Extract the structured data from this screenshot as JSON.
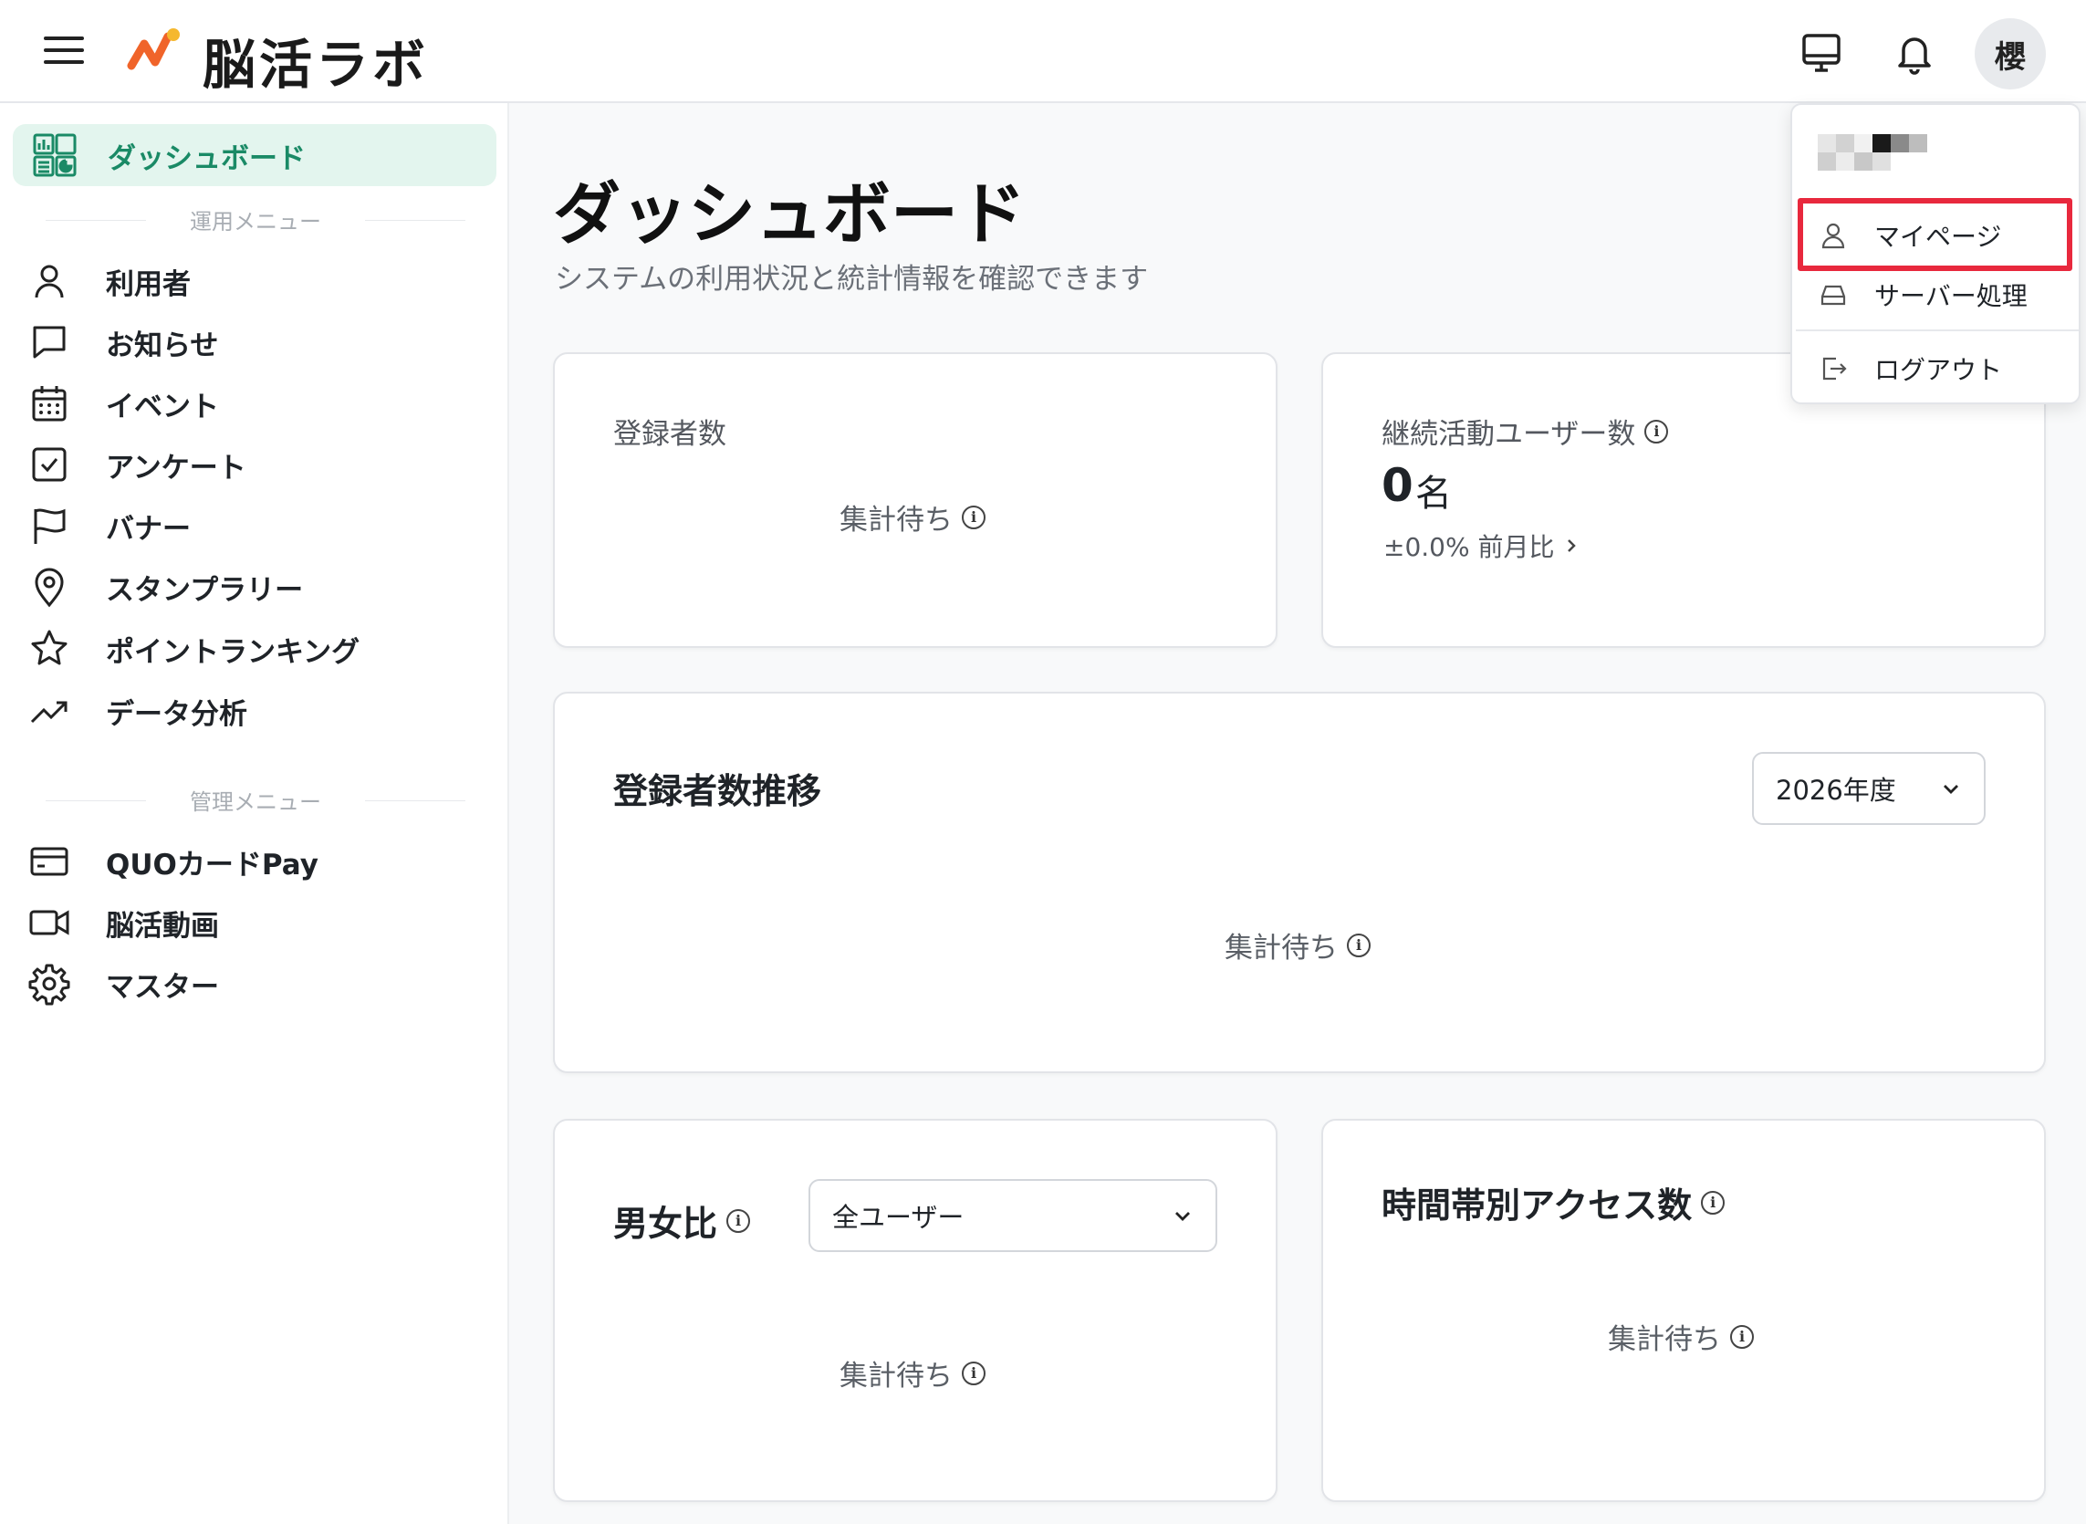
{
  "header": {
    "app_name": "脳活ラボ",
    "avatar_initial": "櫻",
    "icons": [
      "menu-icon",
      "monitor-icon",
      "bell-icon"
    ]
  },
  "sidebar": {
    "active_label": "ダッシュボード",
    "section_ops": "運用メニュー",
    "section_admin": "管理メニュー",
    "ops_items": [
      {
        "label": "利用者",
        "icon": "user-icon"
      },
      {
        "label": "お知らせ",
        "icon": "message-icon"
      },
      {
        "label": "イベント",
        "icon": "calendar-icon"
      },
      {
        "label": "アンケート",
        "icon": "checkbox-icon"
      },
      {
        "label": "バナー",
        "icon": "flag-icon"
      },
      {
        "label": "スタンプラリー",
        "icon": "map-pin-icon"
      },
      {
        "label": "ポイントランキング",
        "icon": "star-icon"
      },
      {
        "label": "データ分析",
        "icon": "trending-up-icon"
      }
    ],
    "admin_items": [
      {
        "label": "QUOカードPay",
        "icon": "credit-card-icon"
      },
      {
        "label": "脳活動画",
        "icon": "video-icon"
      },
      {
        "label": "マスター",
        "icon": "gear-icon"
      }
    ]
  },
  "main": {
    "title": "ダッシュボード",
    "subtitle": "システムの利用状況と統計情報を確認できます",
    "pending_text": "集計待ち",
    "registrants": {
      "title": "登録者数"
    },
    "active_users": {
      "title": "継続活動ユーザー数",
      "value": "0",
      "unit": "名",
      "comparison": "±0.0% 前月比"
    },
    "trend": {
      "title": "登録者数推移",
      "year_select": "2026年度"
    },
    "gender": {
      "title": "男女比",
      "filter_select": "全ユーザー"
    },
    "hourly": {
      "title": "時間帯別アクセス数"
    }
  },
  "dropdown": {
    "items": [
      {
        "label": "マイページ",
        "icon": "user-icon"
      },
      {
        "label": "サーバー処理",
        "icon": "hard-drive-icon"
      },
      {
        "label": "ログアウト",
        "icon": "logout-icon"
      }
    ]
  },
  "colors": {
    "accent": "#1a8a66",
    "active_bg": "#e3f5ee",
    "highlight": "#e8283d"
  }
}
